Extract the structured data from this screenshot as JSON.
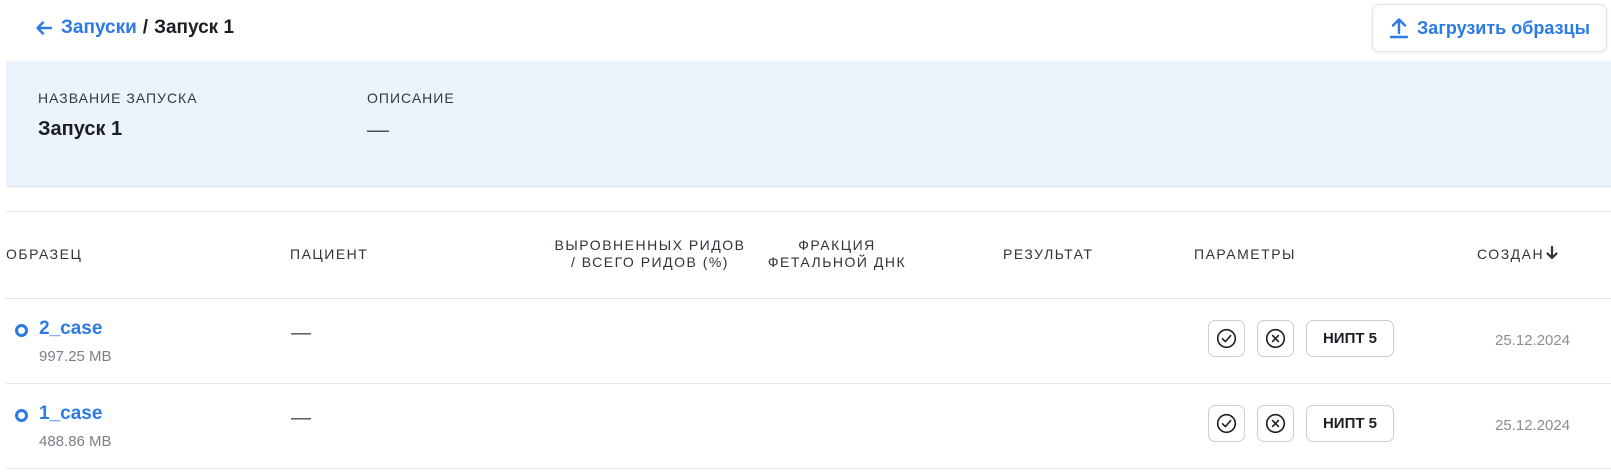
{
  "breadcrumb": {
    "parent": "Запуски",
    "separator": "/",
    "current": "Запуск 1"
  },
  "toolbar": {
    "upload_label": "Загрузить образцы"
  },
  "run_info": {
    "name_label": "НАЗВАНИЕ ЗАПУСКА",
    "name_value": "Запуск 1",
    "description_label": "ОПИСАНИЕ",
    "description_value": "—"
  },
  "table": {
    "headers": {
      "sample": "ОБРАЗЕЦ",
      "patient": "ПАЦИЕНТ",
      "aligned_reads_1": "ВЫРОВНЕННЫХ РИДОВ",
      "aligned_reads_2": "/ ВСЕГО РИДОВ (%)",
      "fetal_fraction_1": "ФРАКЦИЯ",
      "fetal_fraction_2": "ФЕТАЛЬНОЙ ДНК",
      "result": "РЕЗУЛЬТАТ",
      "parameters": "ПАРАМЕТРЫ",
      "created": "СОЗДАН"
    },
    "rows": [
      {
        "sample_name": "2_case",
        "sample_size": "997.25 MB",
        "patient": "—",
        "param_tag": "НИПТ 5",
        "created": "25.12.2024"
      },
      {
        "sample_name": "1_case",
        "sample_size": "488.86 MB",
        "patient": "—",
        "param_tag": "НИПТ 5",
        "created": "25.12.2024"
      }
    ]
  },
  "colors": {
    "accent": "#2c7be5",
    "panel_bg": "#edf3fd",
    "border": "#e1e5ea"
  }
}
